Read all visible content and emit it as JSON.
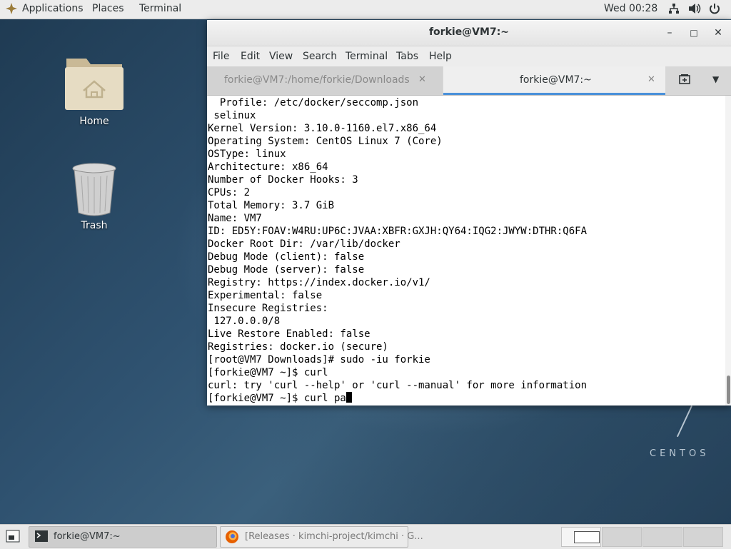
{
  "topbar": {
    "applications": "Applications",
    "places": "Places",
    "terminal": "Terminal",
    "clock": "Wed 00:28",
    "tray_icons": [
      "network-icon",
      "volume-icon",
      "power-icon"
    ]
  },
  "desktop": {
    "icons": [
      {
        "label": "Home",
        "icon": "home-folder-icon"
      },
      {
        "label": "Trash",
        "icon": "trash-icon"
      }
    ],
    "branding": "CENTOS"
  },
  "window": {
    "title": "forkie@VM7:~",
    "controls": {
      "minimize": "–",
      "maximize": "□",
      "close": "✕"
    },
    "menu": [
      "File",
      "Edit",
      "View",
      "Search",
      "Terminal",
      "Tabs",
      "Help"
    ],
    "tabs": [
      {
        "label": "forkie@VM7:/home/forkie/Downloads",
        "active": false
      },
      {
        "label": "forkie@VM7:~",
        "active": true
      }
    ],
    "lines": [
      "  Profile: /etc/docker/seccomp.json",
      " selinux",
      "Kernel Version: 3.10.0-1160.el7.x86_64",
      "Operating System: CentOS Linux 7 (Core)",
      "OSType: linux",
      "Architecture: x86_64",
      "Number of Docker Hooks: 3",
      "CPUs: 2",
      "Total Memory: 3.7 GiB",
      "Name: VM7",
      "ID: ED5Y:FOAV:W4RU:UP6C:JVAA:XBFR:GXJH:QY64:IQG2:JWYW:DTHR:Q6FA",
      "Docker Root Dir: /var/lib/docker",
      "Debug Mode (client): false",
      "Debug Mode (server): false",
      "Registry: https://index.docker.io/v1/",
      "Experimental: false",
      "Insecure Registries:",
      " 127.0.0.0/8",
      "Live Restore Enabled: false",
      "Registries: docker.io (secure)",
      "[root@VM7 Downloads]# sudo -iu forkie",
      "[forkie@VM7 ~]$ curl",
      "curl: try 'curl --help' or 'curl --manual' for more information"
    ],
    "prompt_line": "[forkie@VM7 ~]$ curl pa"
  },
  "taskbar": {
    "items": [
      {
        "label": "forkie@VM7:~",
        "icon": "terminal-icon"
      },
      {
        "label": "[Releases · kimchi-project/kimchi · G...",
        "icon": "firefox-icon"
      }
    ],
    "workspaces": 4
  },
  "colors": {
    "accent": "#4a90d9",
    "terminal_bg": "#ffffff",
    "terminal_fg": "#000000"
  }
}
